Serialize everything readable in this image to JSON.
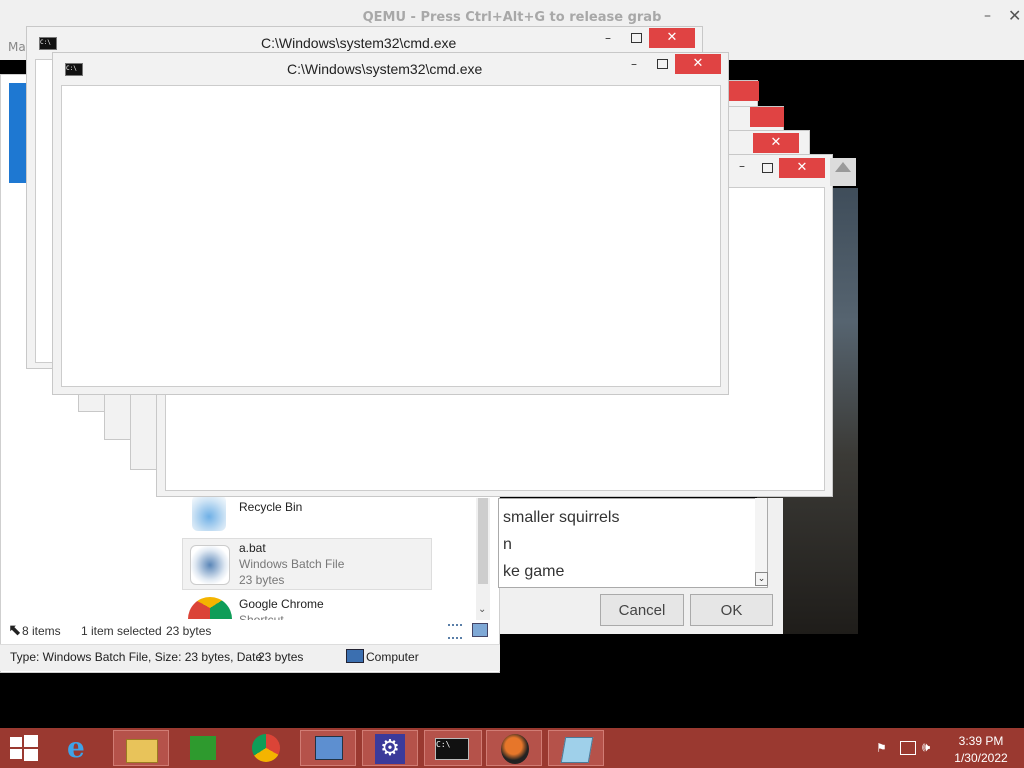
{
  "qemu": {
    "title": "QEMU - Press Ctrl+Alt+G to release grab",
    "menu_label": "Ma",
    "minimize_glyph": "–",
    "close_glyph": "✕"
  },
  "cmd_windows": {
    "title": "C:\\Windows\\system32\\cmd.exe",
    "icon_text": "C:\\",
    "close_glyph": "✕",
    "minimize_glyph": "–"
  },
  "explorer": {
    "files": [
      {
        "name": "Recycle Bin"
      },
      {
        "name": "a.bat",
        "type": "Windows Batch File",
        "size": "23 bytes"
      },
      {
        "name": "Google Chrome",
        "type": "Shortcut"
      }
    ],
    "status": {
      "item_count": "8 items",
      "selection": "1 item selected",
      "selection_size": "23 bytes"
    },
    "details": {
      "type_info": "Type: Windows Batch File, Size: 23 bytes, Date",
      "size": "23 bytes",
      "location": "Computer"
    }
  },
  "dialog": {
    "list_items": [
      "smaller squirrels",
      "n",
      "ke game"
    ],
    "cancel_label": "Cancel",
    "ok_label": "OK"
  },
  "taskbar": {
    "items": [
      {
        "icon": "windows-start-icon"
      },
      {
        "icon": "internet-explorer-icon"
      },
      {
        "icon": "file-explorer-icon"
      },
      {
        "icon": "store-icon"
      },
      {
        "icon": "chrome-icon"
      },
      {
        "icon": "remote-desktop-icon"
      },
      {
        "icon": "settings-gear-icon"
      },
      {
        "icon": "cmd-icon",
        "active": true
      },
      {
        "icon": "qemu-icon"
      },
      {
        "icon": "notepad-icon"
      }
    ],
    "clock": {
      "time": "3:39 PM",
      "date": "1/30/2022"
    },
    "colors": {
      "taskbar": "#9a3930",
      "close_button": "#e04343"
    }
  }
}
